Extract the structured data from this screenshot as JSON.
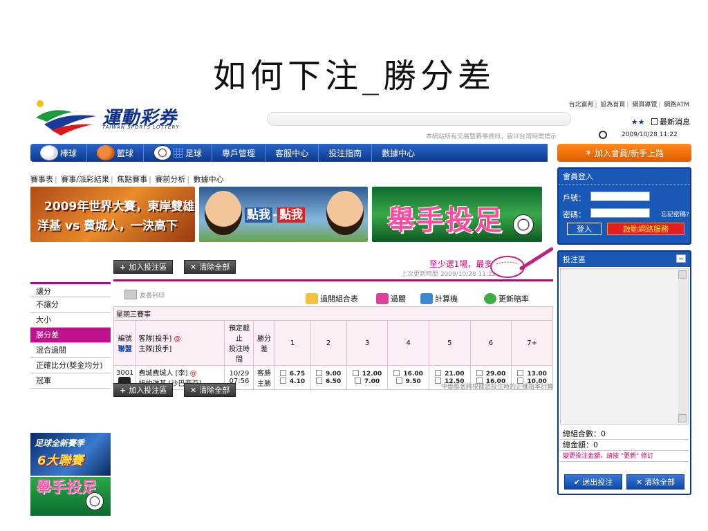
{
  "slide": {
    "title": "如何下注_勝分差"
  },
  "header": {
    "logo_main": "運動彩券",
    "logo_sub": "TAIWAN SPORTS LOTTERY",
    "top_links": [
      "台北富邦",
      "設為首頁",
      "網頁導覽",
      "網路ATM"
    ],
    "stars": "★★",
    "news": "最新消息",
    "notice": "本網站所有交易暨賽事資訊，皆以台灣時間標示",
    "datetime": "2009/10/28 11:22"
  },
  "nav": {
    "items": [
      "棒球",
      "籃球",
      "足球",
      "專戶管理",
      "客服中心",
      "投注指南",
      "數據中心"
    ],
    "join": "加入會員/新手上路"
  },
  "subnav": [
    "賽事表",
    "賽事/派彩結果",
    "焦點賽事",
    "賽前分析",
    "數據中心"
  ],
  "banners": {
    "b1_line1": "2009年世界大賽，東岸雙雄",
    "b1_line2": "洋基 vs 費城人，一決高下",
    "b2_p1": "點我",
    "b2_p2": "點我",
    "b3": "舉手投足"
  },
  "actions": {
    "add": "加入投注區",
    "clear": "清除全部"
  },
  "promo": {
    "text": "至少選1場，最多6場",
    "lastupd": "上次更新時間 2009/10/28 11:22:46"
  },
  "left_menu": [
    "讓分",
    "不讓分",
    "大小",
    "勝分差",
    "混合過關",
    "正確比分(獎金均分)",
    "冠軍"
  ],
  "left_promos": {
    "p1_a": "足球全新賽季",
    "p1_b": "6大聯賽",
    "p2": "舉手投足"
  },
  "toolbar": {
    "print": "友善列印",
    "combo": "過關組合表",
    "pass": "過關",
    "calc": "計算機",
    "refresh": "更新賠率"
  },
  "table": {
    "weekday": "星期三賽事",
    "head": {
      "no": "編號",
      "league": "聯盟",
      "away_label": "客隊[投手]",
      "at": "@",
      "home_label": "主隊[投手]",
      "cutoff1": "預定截止",
      "cutoff2": "投注時間",
      "margin1": "勝分",
      "margin2": "差"
    },
    "columns": [
      "1",
      "2",
      "3",
      "4",
      "5",
      "6",
      "7+"
    ],
    "game": {
      "no": "3001",
      "away": "費城費城人 [李]",
      "at": "@",
      "home": "紐約洋基 [沙巴西亞]",
      "date": "10/29",
      "time": "07:56",
      "away_side": "客勝",
      "home_side": "主勝",
      "away_odds": [
        "6.75",
        "9.00",
        "12.00",
        "16.00",
        "21.00",
        "29.00",
        "13.00"
      ],
      "home_odds": [
        "4.10",
        "6.50",
        "7.00",
        "9.50",
        "12.50",
        "16.00",
        "10.00"
      ]
    },
    "note": "中獎獎金將根據您投注時的正確賠率計算"
  },
  "login": {
    "title": "會員登入",
    "account": "戶號：",
    "password": "密碼：",
    "forgot": "忘記密碼?",
    "login_btn": "登入",
    "service_btn": "啟動網路服務"
  },
  "betzone": {
    "title": "投注區",
    "total_combos": "總組合數：0",
    "total_amount": "總金額：0",
    "warning": "變更投注金額，請按 \"更新\" 修訂",
    "submit": "送出投注",
    "clear": "清除全部"
  }
}
